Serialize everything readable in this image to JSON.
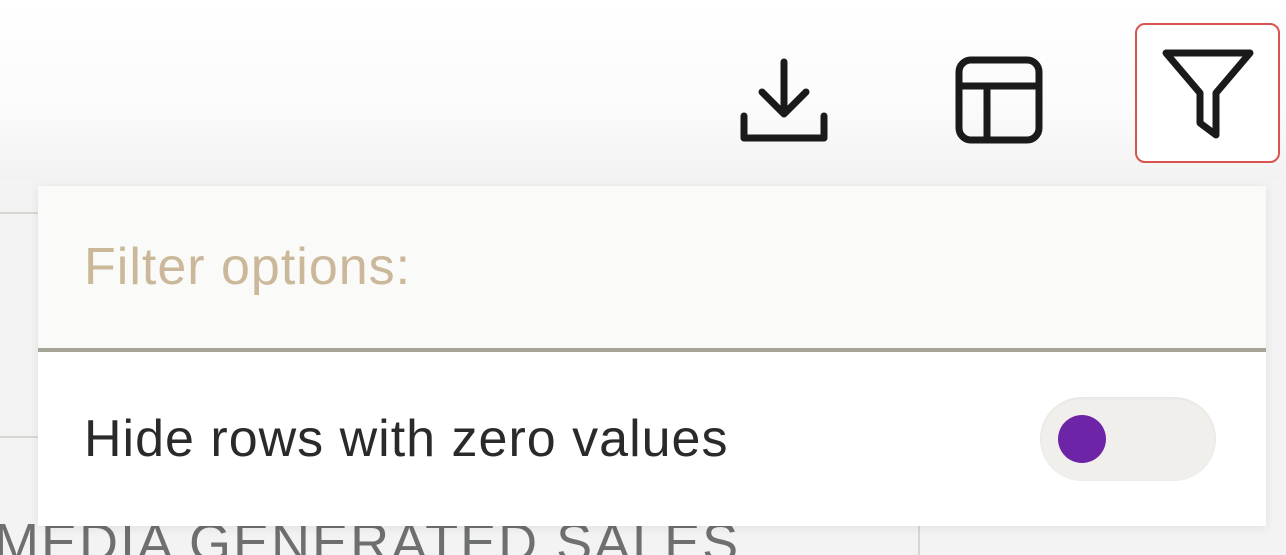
{
  "toolbar": {
    "download_icon": "download-icon",
    "table_icon": "table-layout-icon",
    "filter_icon": "filter-icon"
  },
  "filter_dropdown": {
    "title": "Filter options:",
    "options": [
      {
        "label": "Hide rows with zero values",
        "enabled": false
      }
    ]
  },
  "background": {
    "column_header": "MEDIA GENERATED SALES"
  },
  "colors": {
    "accent": "#6d24a6",
    "highlight_border": "#d9534f",
    "title_text": "#cbb89a"
  }
}
